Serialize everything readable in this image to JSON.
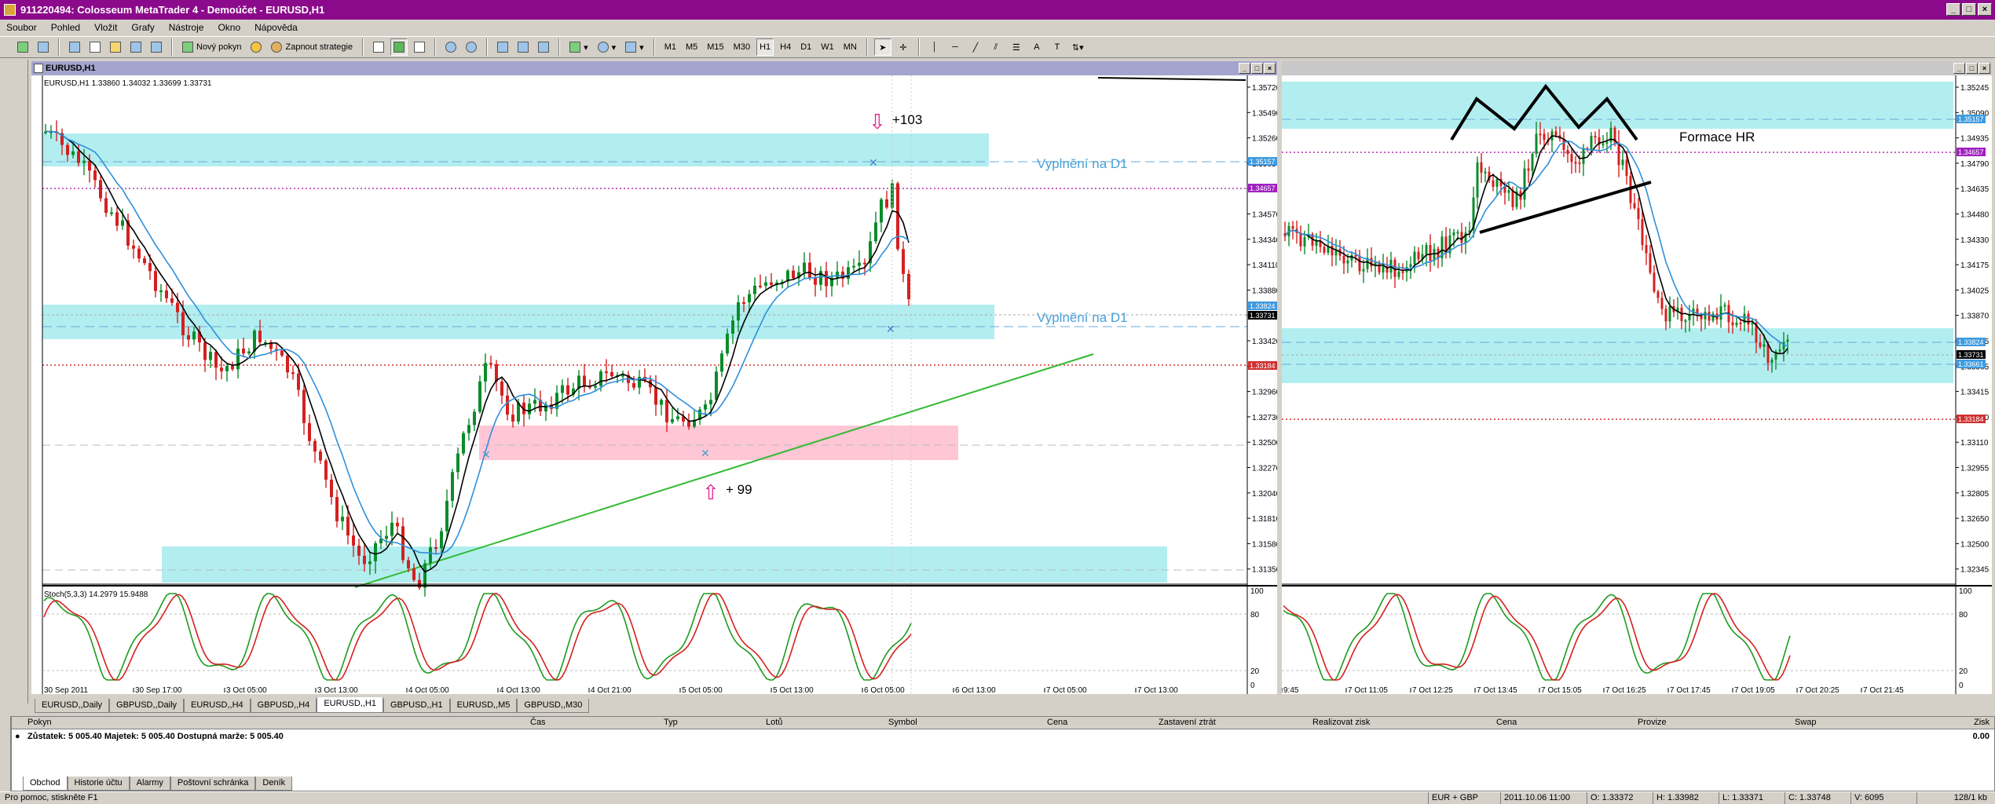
{
  "window": {
    "title": "911220494: Colosseum MetaTrader 4 - Demoúčet - EURUSD,H1"
  },
  "menu": [
    "Soubor",
    "Pohled",
    "Vložit",
    "Grafy",
    "Nástroje",
    "Okno",
    "Nápověda"
  ],
  "toolbar": {
    "new_order": "Nový pokyn",
    "strategies": "Zapnout strategie",
    "timeframes": [
      "M1",
      "M5",
      "M15",
      "M30",
      "H1",
      "H4",
      "D1",
      "W1",
      "MN"
    ],
    "active_timeframe": "H1"
  },
  "chart_left": {
    "window_title": "EURUSD,H1",
    "info": "EURUSD,H1  1.33860 1.34032 1.33699 1.33731",
    "price_labels": [
      "1.35720",
      "1.35490",
      "1.35260",
      "1.35030",
      "1.34800",
      "1.34570",
      "1.34340",
      "1.34110",
      "1.33880",
      "1.33650",
      "1.33420",
      "1.33190",
      "1.32960",
      "1.32730",
      "1.32500",
      "1.32270",
      "1.32040",
      "1.31810",
      "1.31580",
      "1.31350"
    ],
    "time_labels": [
      "30 Sep 2011",
      "30 Sep 17:00",
      "3 Oct 05:00",
      "3 Oct 13:00",
      "4 Oct 05:00",
      "4 Oct 13:00",
      "4 Oct 21:00",
      "5 Oct 05:00",
      "5 Oct 13:00",
      "6 Oct 05:00",
      "6 Oct 13:00",
      "7 Oct 05:00",
      "7 Oct 13:00"
    ],
    "zone_label_1": "Vyplnění na D1",
    "zone_label_2": "Vyplnění na D1",
    "annot_down": "+103",
    "annot_up": "+ 99",
    "current_price": "1.33731",
    "tag_blue": "1.33824",
    "tag_red": "1.33184",
    "tag_purple": "1.34657",
    "tag_zone": "1.35157",
    "stoch_info": "Stoch(5,3,3) 14.2979 15.9488",
    "stoch_levels": [
      "100",
      "80",
      "20",
      "0"
    ]
  },
  "chart_right": {
    "price_labels": [
      "1.35245",
      "1.35090",
      "1.34935",
      "1.34790",
      "1.34635",
      "1.34480",
      "1.34330",
      "1.34175",
      "1.34025",
      "1.33870",
      "1.33715",
      "1.33565",
      "1.33415",
      "1.33260",
      "1.33110",
      "1.32955",
      "1.32805",
      "1.32650",
      "1.32500",
      "1.32345"
    ],
    "time_labels": [
      "9:45",
      "7 Oct 11:05",
      "7 Oct 12:25",
      "7 Oct 13:45",
      "7 Oct 15:05",
      "7 Oct 16:25",
      "7 Oct 17:45",
      "7 Oct 19:05",
      "7 Oct 20:25",
      "7 Oct 21:45"
    ],
    "pattern_label": "Formace HR",
    "current_price": "1.33731",
    "tag_blue": "1.33824",
    "tag_red": "1.33184",
    "tag_purple": "1.34657",
    "tag_zone": "1.35157",
    "tag_zone2": "1.33661",
    "stoch_levels": [
      "100",
      "80",
      "20",
      "0"
    ]
  },
  "tabs": [
    "EURUSD,,Daily",
    "GBPUSD,,Daily",
    "EURUSD,,H4",
    "GBPUSD,,H4",
    "EURUSD,,H1",
    "GBPUSD,,H1",
    "EURUSD,,M5",
    "GBPUSD,,M30"
  ],
  "active_tab": "EURUSD,,H1",
  "terminal": {
    "headers": [
      "Pokyn",
      "Čas",
      "Typ",
      "Lotů",
      "Symbol",
      "Cena",
      "Zastavení ztrát",
      "Realizovat zisk",
      "Cena",
      "Provize",
      "Swap",
      "Zisk"
    ],
    "balance": "Zůstatek: 5 005.40  Majetek: 5 005.40  Dostupná marže: 5 005.40",
    "profit": "0.00",
    "tabs": [
      "Obchod",
      "Historie účtu",
      "Alarmy",
      "Poštovní schránka",
      "Deník"
    ]
  },
  "status": {
    "help": "Pro pomoc, stiskněte F1",
    "profile": "EUR + GBP",
    "datetime": "2011.10.06 11:00",
    "open": "O: 1.33372",
    "high": "H: 1.33982",
    "low": "L: 1.33371",
    "close": "C: 1.33748",
    "volume": "V: 6095",
    "traffic": "128/1 kb"
  },
  "colors": {
    "title": "#8b0a8b",
    "zone": "#b2eef0",
    "support_zone": "#ffc6d6",
    "trendline": "#33bb33",
    "bull": "#0a8c2a",
    "bear": "#d42020"
  }
}
